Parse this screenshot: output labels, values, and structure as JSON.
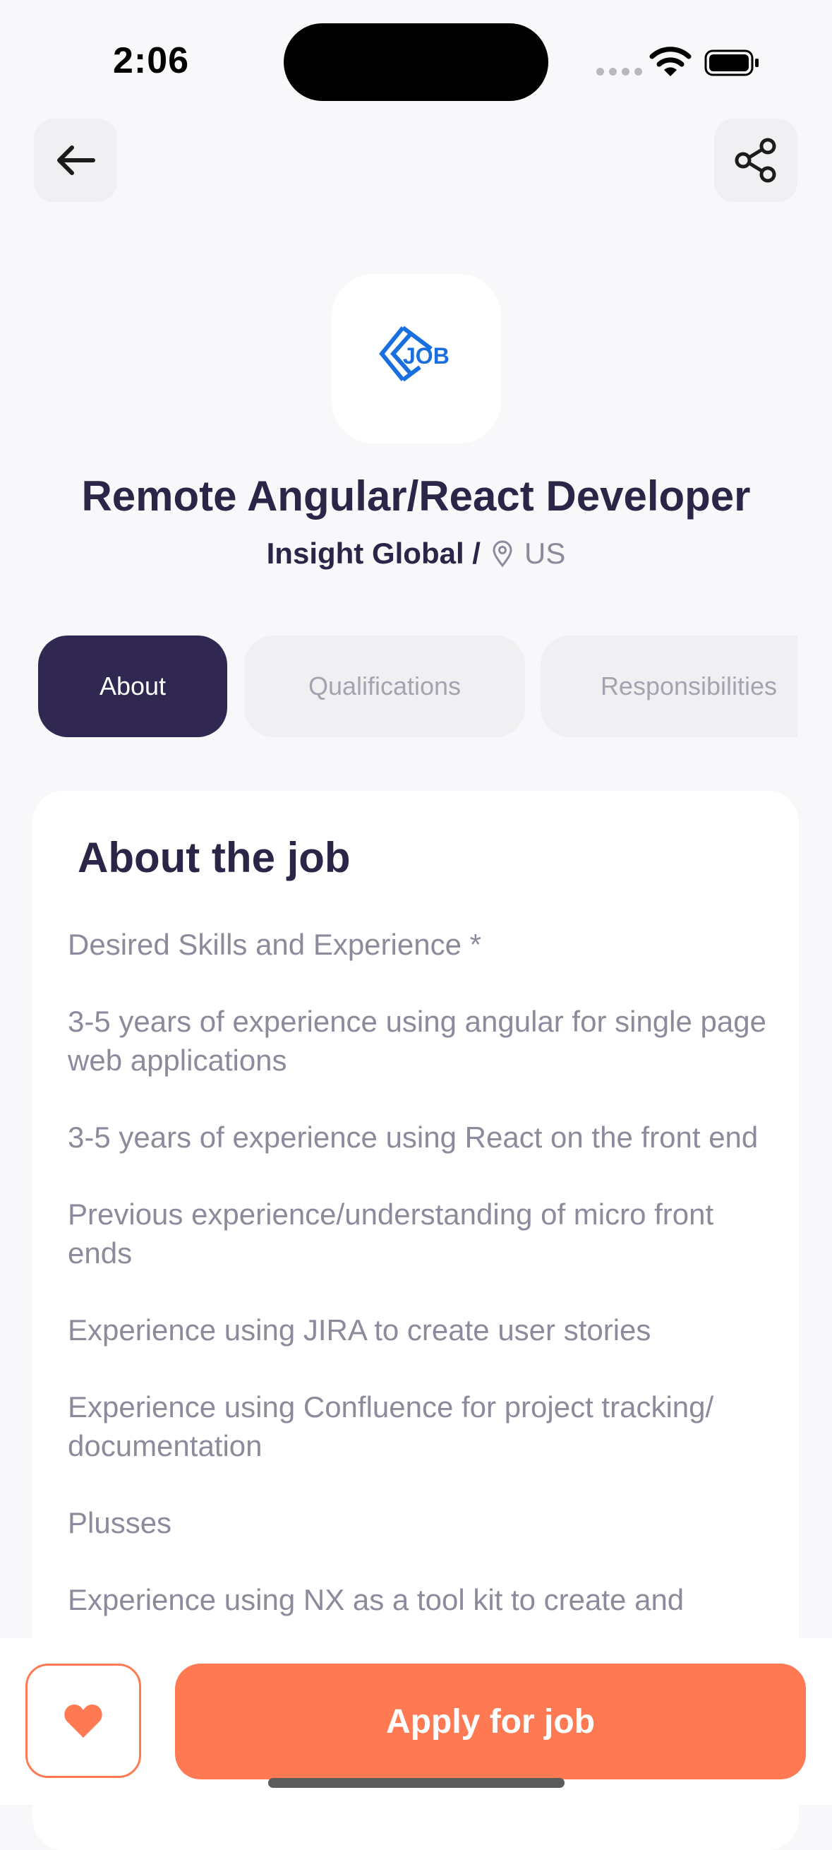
{
  "status_bar": {
    "time": "2:06"
  },
  "header": {
    "back_icon": "arrow-left-icon",
    "share_icon": "share-icon"
  },
  "company_logo": {
    "text": "JOB",
    "color": "#1a6fe0"
  },
  "job": {
    "title": "Remote Angular/React Developer",
    "company": "Insight Global /",
    "location": "US"
  },
  "tabs": [
    {
      "label": "About",
      "active": true
    },
    {
      "label": "Qualifications",
      "active": false
    },
    {
      "label": "Responsibilities",
      "active": false
    }
  ],
  "about": {
    "heading": "About the job",
    "paragraphs": [
      "Desired Skills and Experience *",
      "3-5 years of experience using angular for single page web applications",
      "3-5 years of experience using React on the front end",
      "Previous experience/understanding of micro front ends",
      "Experience using JIRA to create user stories",
      "Experience using Confluence for project tracking/ documentation",
      "Plusses",
      "Experience using NX as a tool kit to create and"
    ]
  },
  "actions": {
    "favorite_icon": "heart-icon",
    "apply_label": "Apply for job"
  },
  "colors": {
    "primary": "#302850",
    "accent": "#ff7a52",
    "muted_text": "#8d8a9c"
  }
}
